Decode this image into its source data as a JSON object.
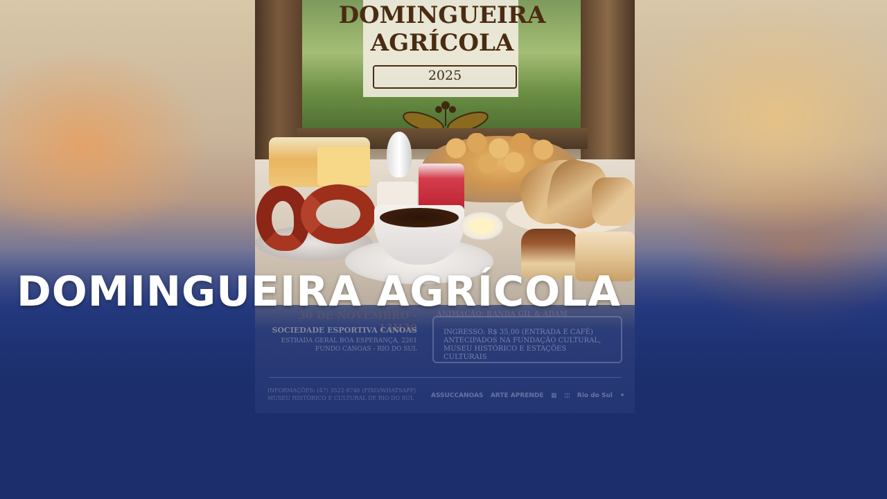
{
  "headline": "DOMINGUEIRA AGRÍCOLA",
  "poster": {
    "title_line1": "DOMINGUEIRA",
    "title_line2": "AGRÍCOLA",
    "year": "2025",
    "date": "30 DE NOVEMBRO - 13H30",
    "venue": "SOCIEDADE ESPORTIVA CANOAS",
    "address_line1": "ESTRADA GERAL BOA ESPERANÇA, 2261",
    "address_line2": "FUNDO CANOAS - RIO DO SUL",
    "animation": "ANIMAÇÃO: BANDA GIL & ADAM",
    "ticket_line1": "INGRESSO: R$ 35,00 (ENTRADA E CAFÉ)",
    "ticket_line2": "ANTECIPADOS NA FUNDAÇÃO CULTURAL,",
    "ticket_line3": "MUSEU HISTÓRICO E ESTAÇÕES CULTURAIS",
    "contact_line1": "INFORMAÇÕES: (47) 3522-8746 (FIXO/WHATSAPP)",
    "contact_line2": "MUSEU HISTÓRICO E CULTURAL DE RIO DO SUL",
    "logos": [
      "ASSUCCANOAS",
      "ARTE APRENDE",
      "▦",
      "◫",
      "Rio do Sul",
      "✦"
    ]
  },
  "colors": {
    "background_blue": "#1c2f6c",
    "headline": "#ffffff",
    "poster_title": "#4a2c12"
  }
}
